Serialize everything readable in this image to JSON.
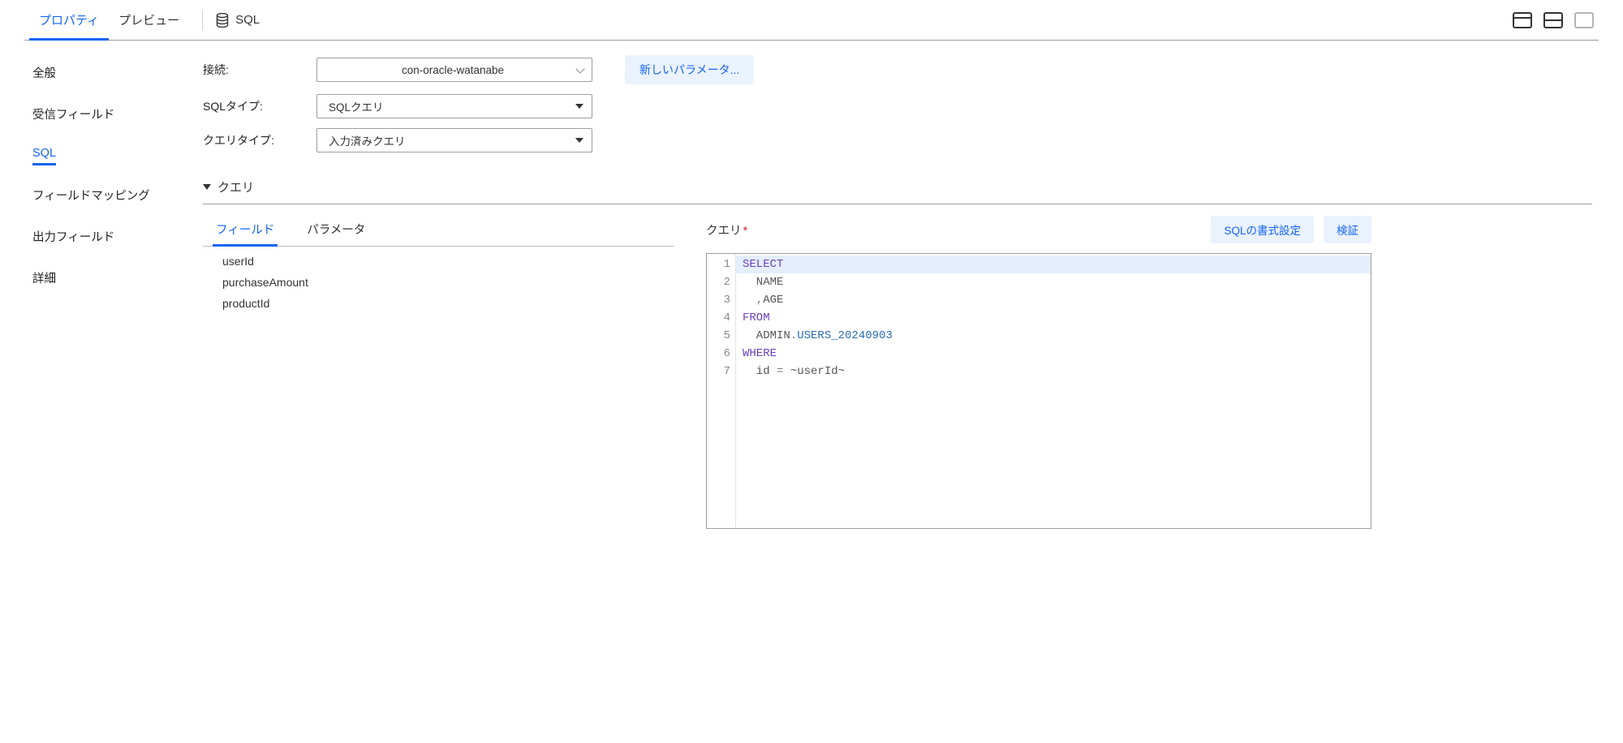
{
  "top_tabs": {
    "property": "プロパティ",
    "preview": "プレビュー"
  },
  "context_label": "SQL",
  "sidebar": {
    "general": "全般",
    "receive_fields": "受信フィールド",
    "sql": "SQL",
    "field_mapping": "フィールドマッピング",
    "output_fields": "出力フィールド",
    "details": "詳細"
  },
  "form": {
    "connection": {
      "label": "接続:",
      "value": "con-oracle-watanabe"
    },
    "sql_type": {
      "label": "SQLタイプ:",
      "value": "SQLクエリ"
    },
    "query_type": {
      "label": "クエリタイプ:",
      "value": "入力済みクエリ"
    },
    "new_param_btn": "新しいパラメータ..."
  },
  "query_section": {
    "header": "クエリ",
    "inner_tabs": {
      "fields": "フィールド",
      "params": "パラメータ"
    },
    "field_list": [
      "userId",
      "purchaseAmount",
      "productId"
    ],
    "query_label": "クエリ",
    "format_sql_btn": "SQLの書式設定",
    "validate_btn": "検証"
  },
  "sql_code": {
    "lines": [
      {
        "n": "1",
        "tokens": [
          {
            "cls": "kw",
            "t": "SELECT"
          }
        ]
      },
      {
        "n": "2",
        "tokens": [
          {
            "cls": "txt",
            "t": "  NAME"
          }
        ]
      },
      {
        "n": "3",
        "tokens": [
          {
            "cls": "txt",
            "t": "  "
          },
          {
            "cls": "punct",
            "t": ","
          },
          {
            "cls": "txt",
            "t": "AGE"
          }
        ]
      },
      {
        "n": "4",
        "tokens": [
          {
            "cls": "kw",
            "t": "FROM"
          }
        ]
      },
      {
        "n": "5",
        "tokens": [
          {
            "cls": "txt",
            "t": "  ADMIN"
          },
          {
            "cls": "punct",
            "t": "."
          },
          {
            "cls": "id",
            "t": "USERS_20240903"
          }
        ]
      },
      {
        "n": "6",
        "tokens": [
          {
            "cls": "kw",
            "t": "WHERE"
          }
        ]
      },
      {
        "n": "7",
        "tokens": [
          {
            "cls": "txt",
            "t": "  id "
          },
          {
            "cls": "punct",
            "t": "="
          },
          {
            "cls": "txt",
            "t": " ~userId~"
          }
        ]
      }
    ]
  }
}
